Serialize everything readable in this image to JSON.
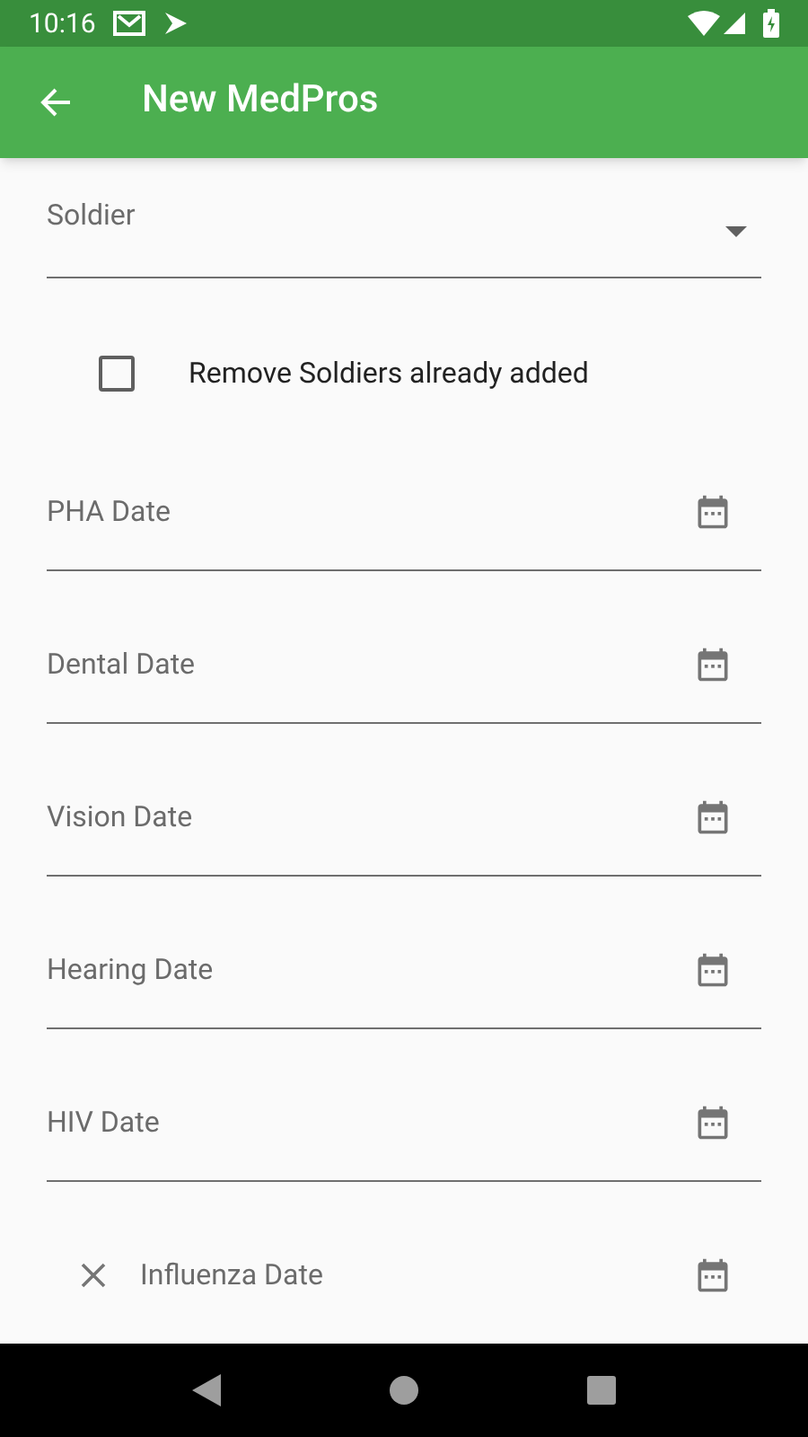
{
  "status_bar": {
    "time": "10:16"
  },
  "app_bar": {
    "title": "New MedPros"
  },
  "soldier_dropdown": {
    "label": "Soldier"
  },
  "remove_added": {
    "label": "Remove Soldiers already added",
    "checked": false
  },
  "date_fields": [
    {
      "label": "PHA Date",
      "kind": "date"
    },
    {
      "label": "Dental Date",
      "kind": "date"
    },
    {
      "label": "Vision Date",
      "kind": "date"
    },
    {
      "label": "Hearing Date",
      "kind": "date"
    },
    {
      "label": "HIV Date",
      "kind": "date"
    },
    {
      "label": "Influenza Date",
      "kind": "clearable"
    }
  ]
}
